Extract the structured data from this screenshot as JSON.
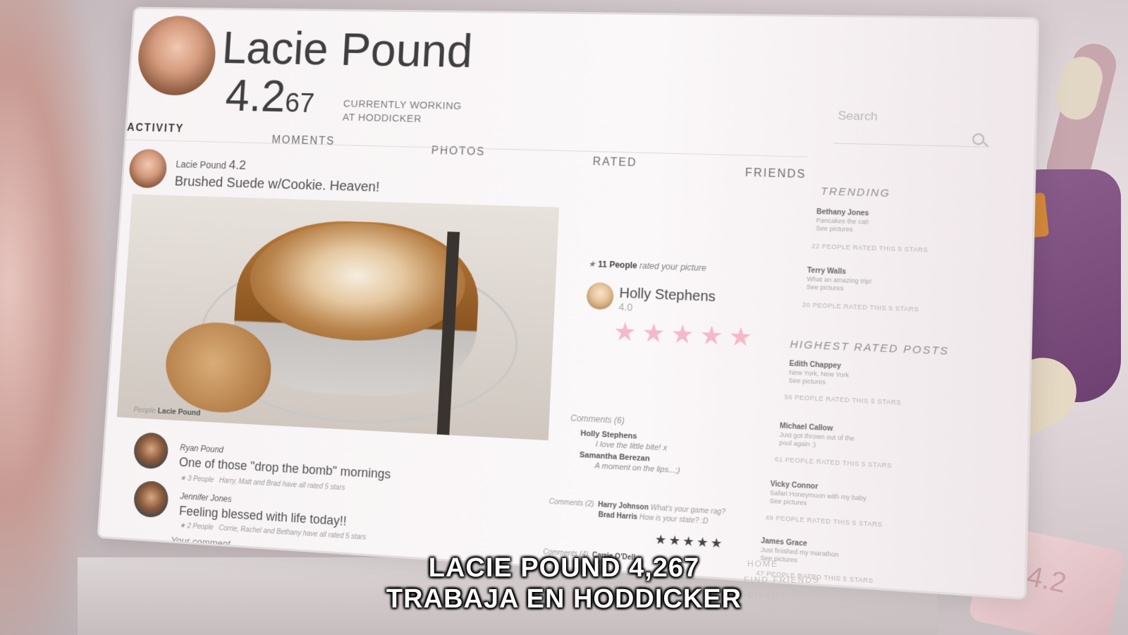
{
  "profile": {
    "name": "Lacie Pound",
    "score_main": "4.2",
    "score_decimals": "67",
    "job_line1": "CURRENTLY WORKING",
    "job_line2": "AT HODDICKER"
  },
  "search": {
    "label": "Search"
  },
  "nav": {
    "activity": "ACTIVITY",
    "moments": "MOMENTS",
    "photos": "PHOTOS",
    "rated": "RATED",
    "friends": "FRIENDS"
  },
  "main_post": {
    "author": "Lacie Pound",
    "author_score": "4.2",
    "text": "Brushed Suede w/Cookie. Heaven!",
    "people_label": "People",
    "people_value": "Lacie Pound"
  },
  "rating_panel": {
    "count": "11 People",
    "count_suffix": "rated your picture",
    "rater_name": "Holly Stephens",
    "rater_score": "4.0",
    "stars": "★★★★★",
    "comments_label": "Comments (6)",
    "comments": [
      {
        "name": "Holly Stephens",
        "text": "I love the little bite! x"
      },
      {
        "name": "Samantha Berezan",
        "text": "A moment on the lips...;)"
      }
    ]
  },
  "feed": [
    {
      "author": "Ryan Pound",
      "text": "One of those \"drop the bomb\" mornings",
      "people": "3 People",
      "rated_note": "Harry, Matt and Brad have all rated 5 stars",
      "comments_label": "Comments (2)",
      "comments": [
        {
          "name": "Harry Johnson",
          "text": "What's your game rag?"
        },
        {
          "name": "Brad Harris",
          "text": "How is your state? :D"
        }
      ]
    },
    {
      "author": "Jennifer Jones",
      "text": "Feeling blessed with life today!!",
      "people": "2 People",
      "rated_note": "Corrie, Rachel and Bethany have all rated 5 stars",
      "comments_label": "Comments (4)",
      "comments": [
        {
          "name": "Carrie O'Dell",
          "text": ""
        }
      ]
    }
  ],
  "black_stars": "★★★★★",
  "comment_box_placeholder": "Your comment",
  "trending": {
    "title": "TRENDING",
    "items": [
      {
        "name": "Bethany Jones",
        "sub1": "Pancakes the cat!",
        "sub2": "See pictures",
        "count": "22 PEOPLE RATED THIS 5 STARS"
      },
      {
        "name": "Terry Walls",
        "sub1": "What an amazing trip!",
        "sub2": "See pictures",
        "count": "20 PEOPLE RATED THIS 5 STARS"
      }
    ]
  },
  "highest_rated": {
    "title": "HIGHEST RATED POSTS",
    "items": [
      {
        "name": "Edith Chappey",
        "sub1": "New York, New York",
        "sub2": "See pictures",
        "count": "56 PEOPLE RATED THIS 5 STARS"
      },
      {
        "name": "Michael Callow",
        "sub1": "Just got thrown out of the",
        "sub2": "pool again :)",
        "count": "61 PEOPLE RATED THIS 5 STARS"
      },
      {
        "name": "Vicky Connor",
        "sub1": "Safari Honeymoon with my baby",
        "sub2": "See pictures",
        "count": "49 PEOPLE RATED THIS 5 STARS"
      },
      {
        "name": "James Grace",
        "sub1": "Just finished my marathon",
        "sub2": "See pictures",
        "count": "47 PEOPLE RATED THIS 5 STARS"
      }
    ]
  },
  "footer": {
    "home": "HOME",
    "find_friends": "FIND FRIENDS",
    "privacy": "PRIVACY"
  },
  "phone_badge": "4.2",
  "subtitles": {
    "line1": "LACIE POUND 4,267",
    "line2": "TRABAJA EN HODDICKER"
  }
}
